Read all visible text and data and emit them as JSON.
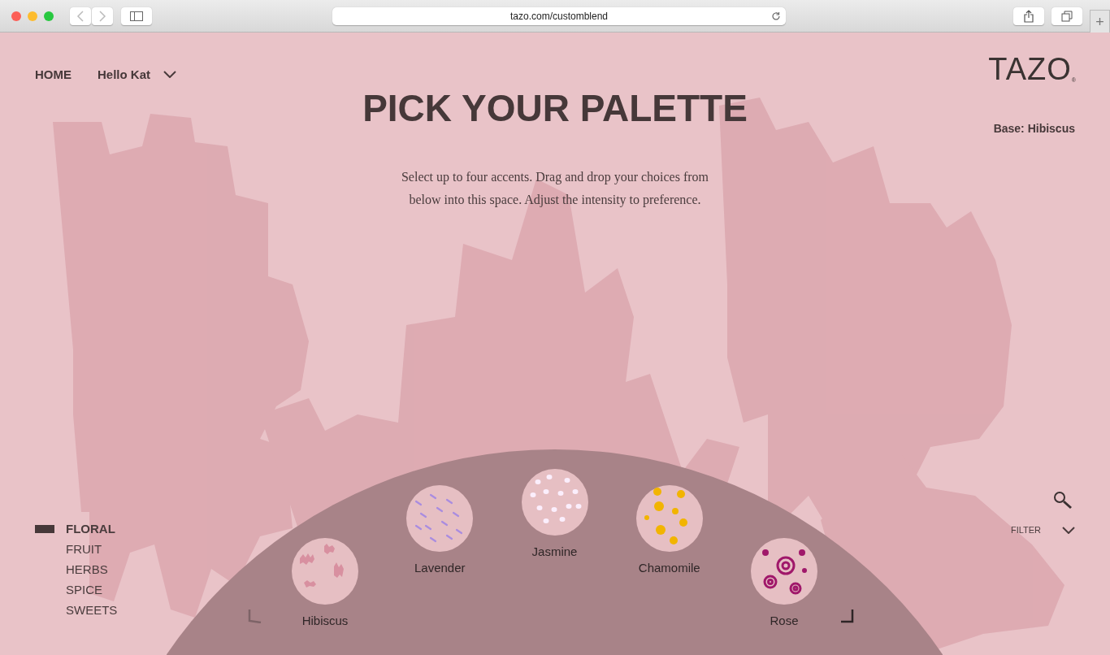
{
  "browser": {
    "url": "tazo.com/customblend",
    "new_tab": "+"
  },
  "nav": {
    "home": "HOME",
    "user": "Hello Kat"
  },
  "logo": {
    "text": "TAZO",
    "mark": "®"
  },
  "title": "PICK YOUR PALETTE",
  "base": "Base: Hibiscus",
  "instructions": "Select up to four accents. Drag and drop your choices from below into this space. Adjust the intensity to preference.",
  "categories": [
    {
      "label": "FLORAL",
      "selected": true
    },
    {
      "label": "FRUIT",
      "selected": false
    },
    {
      "label": "HERBS",
      "selected": false
    },
    {
      "label": "SPICE",
      "selected": false
    },
    {
      "label": "SWEETS",
      "selected": false
    }
  ],
  "ingredients": [
    {
      "name": "Hibiscus",
      "kind": "streaks"
    },
    {
      "name": "Lavender",
      "kind": "dashes"
    },
    {
      "name": "Jasmine",
      "kind": "dots"
    },
    {
      "name": "Chamomile",
      "kind": "blobs"
    },
    {
      "name": "Rose",
      "kind": "swirls"
    }
  ],
  "filter": {
    "label": "FILTER"
  }
}
